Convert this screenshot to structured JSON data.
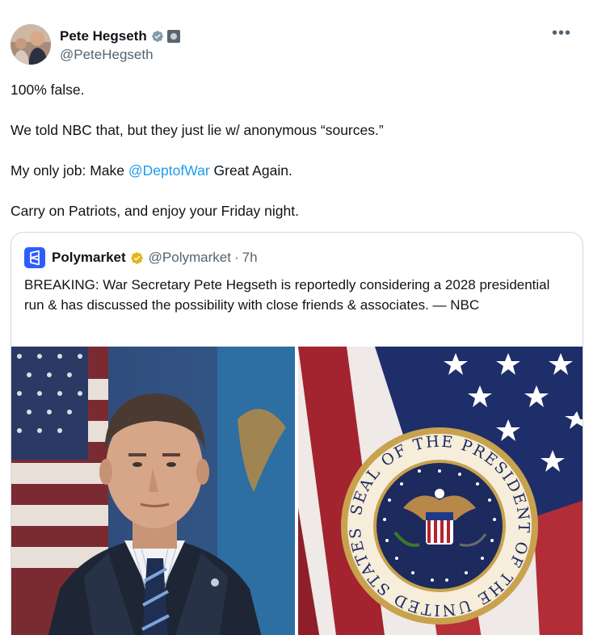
{
  "author": {
    "display_name": "Pete Hegseth",
    "handle": "@PeteHegseth",
    "avatar_icon": "profile-photo",
    "verified_badge": "grey-verified-icon",
    "affiliation_badge": "government-affiliation-icon"
  },
  "menu": {
    "more_label": "•••"
  },
  "tweet": {
    "line1": "100% false.",
    "line2": "We told NBC that, but they just lie w/ anonymous “sources.”",
    "line3_prefix": "My only job: Make ",
    "line3_mention": "@DeptofWar",
    "line3_suffix": " Great Again.",
    "line4": "Carry on Patriots, and enjoy your Friday night."
  },
  "quote": {
    "display_name": "Polymarket",
    "handle": "@Polymarket",
    "separator": "·",
    "time": "7h",
    "text": "BREAKING: War Secretary Pete Hegseth is reportedly considering a 2028 presidential run & has discussed the possibility with close friends & associates. — NBC",
    "seal_top_text": "SEAL OF THE PRESIDENT OF THE UNITED STATES",
    "colors": {
      "brand": "#2e5cff",
      "gold_badge": "#e2b719",
      "mention": "#1d9bf0"
    }
  }
}
